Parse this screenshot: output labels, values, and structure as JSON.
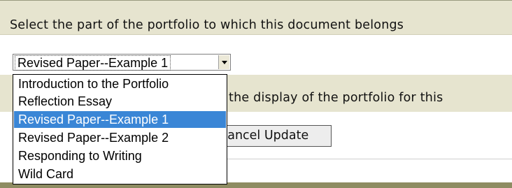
{
  "form": {
    "part_prompt": "Select the part of the portfolio to which this document belongs",
    "display_prompt": "Enter the title you want shown in the display of the portfolio for this",
    "update_button_label": "Cancel Update"
  },
  "part_select": {
    "selected_value": "Revised Paper--Example 1",
    "options": [
      {
        "label": "Introduction to the Portfolio",
        "selected": false
      },
      {
        "label": "Reflection Essay",
        "selected": false
      },
      {
        "label": "Revised Paper--Example 1",
        "selected": true
      },
      {
        "label": "Revised Paper--Example 2",
        "selected": false
      },
      {
        "label": "Responding to Writing",
        "selected": false
      },
      {
        "label": "Wild Card",
        "selected": false
      }
    ]
  },
  "colors": {
    "band": "#e6e4cf",
    "highlight": "#3a86d6",
    "footer": "#8e8c62"
  }
}
